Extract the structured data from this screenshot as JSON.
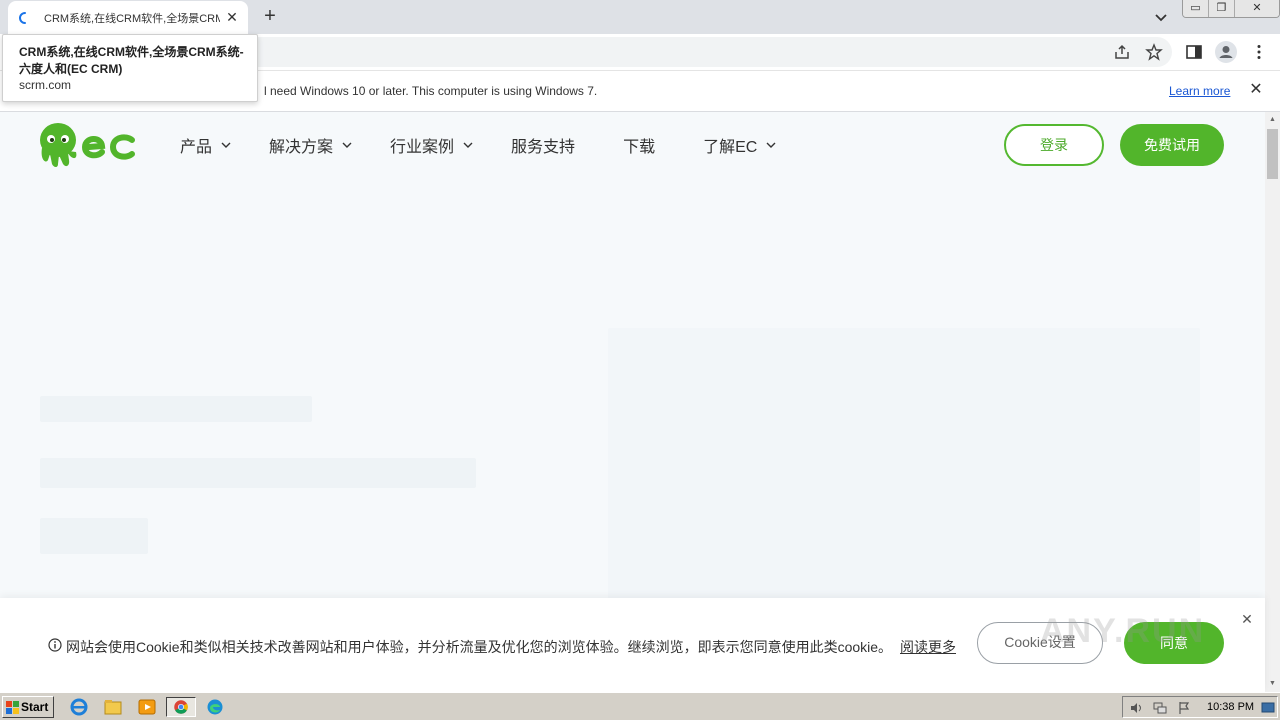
{
  "browser": {
    "tab": {
      "title": "CRM系统,在线CRM软件,全场景CRM",
      "close": "✕"
    },
    "new_tab": "+",
    "tooltip": {
      "title": "CRM系统,在线CRM软件,全场景CRM系统-六度人和(EC CRM)",
      "url": "scrm.com"
    },
    "window_buttons": {
      "minimize": "▭",
      "restore": "❐",
      "close": "✕"
    },
    "infobar": {
      "message": "l need Windows 10 or later. This computer is using Windows 7.",
      "link": "Learn more",
      "close": "✕"
    }
  },
  "site": {
    "brand_color": "#52b52b",
    "nav": [
      {
        "label": "产品",
        "has_dropdown": true
      },
      {
        "label": "解决方案",
        "has_dropdown": true
      },
      {
        "label": "行业案例",
        "has_dropdown": true
      },
      {
        "label": "服务支持",
        "has_dropdown": false
      },
      {
        "label": "下载",
        "has_dropdown": false
      },
      {
        "label": "了解EC",
        "has_dropdown": true
      }
    ],
    "login": "登录",
    "trial": "免费试用"
  },
  "cookie": {
    "icon": "info-icon",
    "message": "网站会使用Cookie和类似相关技术改善网站和用户体验，并分析流量及优化您的浏览体验。继续浏览，即表示您同意使用此类cookie。",
    "more": "阅读更多",
    "settings": "Cookie设置",
    "agree": "同意",
    "close": "✕",
    "watermark": "ANY.RUN"
  },
  "taskbar": {
    "start": "Start",
    "clock": "10:38 PM"
  }
}
